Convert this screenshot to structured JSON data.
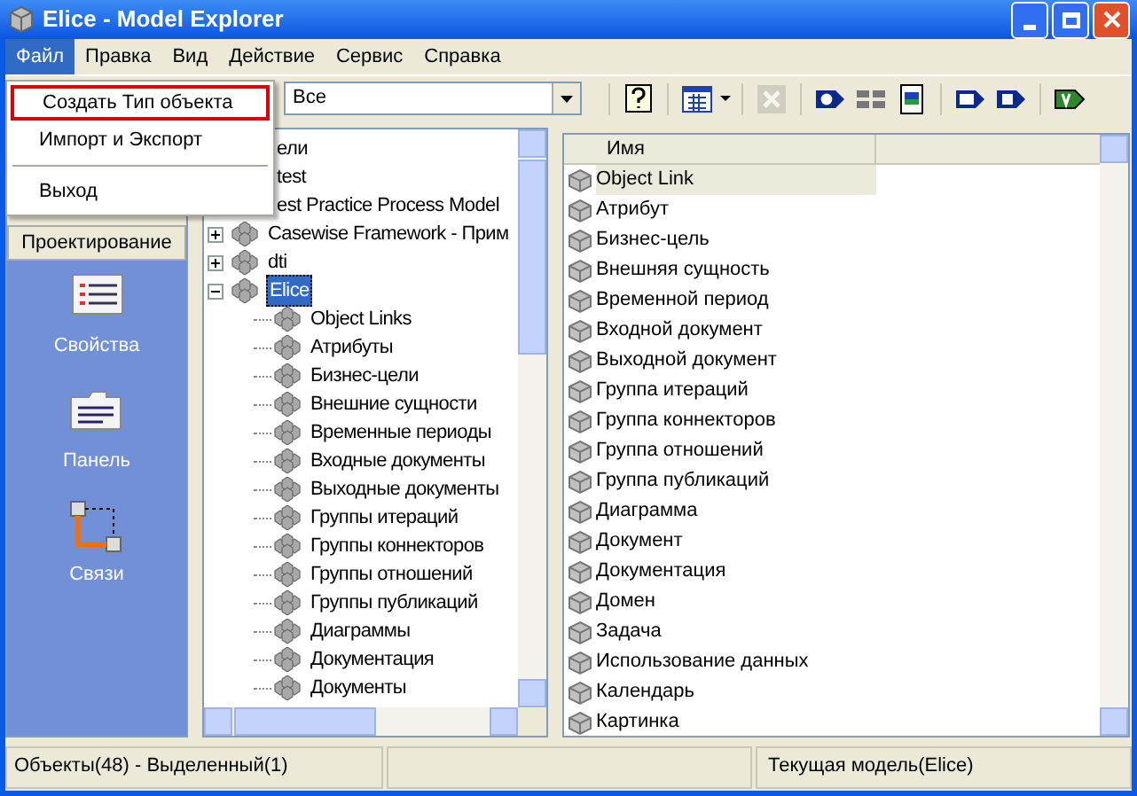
{
  "window": {
    "title": "Elice - Model Explorer"
  },
  "menu_bar": [
    {
      "label": "Файл",
      "selected": true
    },
    {
      "label": "Правка",
      "selected": false
    },
    {
      "label": "Вид",
      "selected": false
    },
    {
      "label": "Действие",
      "selected": false
    },
    {
      "label": "Сервис",
      "selected": false
    },
    {
      "label": "Справка",
      "selected": false
    }
  ],
  "file_menu": [
    {
      "kind": "item",
      "label": "Создать Тип объекта",
      "highlighted": true
    },
    {
      "kind": "item",
      "label": "Импорт и Экспорт",
      "highlighted": false
    },
    {
      "kind": "separator"
    },
    {
      "kind": "item",
      "label": "Выход",
      "highlighted": false
    }
  ],
  "toolbar": {
    "filter": {
      "value": "Все"
    },
    "tools": [
      {
        "kind": "help",
        "disabled": false
      },
      {
        "kind": "view",
        "disabled": false
      },
      {
        "kind": "delete",
        "disabled": true
      },
      {
        "kind": "number",
        "disabled": false
      },
      {
        "kind": "grid",
        "disabled": false
      },
      {
        "kind": "picture",
        "disabled": false
      },
      {
        "kind": "cp",
        "disabled": false
      },
      {
        "kind": "a",
        "disabled": false
      },
      {
        "kind": "v",
        "disabled": false
      }
    ]
  },
  "design_panel": {
    "title": "Проектирование",
    "items": [
      {
        "kind": "properties",
        "label": "Свойства"
      },
      {
        "kind": "panel",
        "label": "Панель"
      },
      {
        "kind": "links",
        "label": "Связи"
      }
    ]
  },
  "tree": [
    {
      "label": "ели",
      "selected": false
    },
    {
      "label": "test",
      "selected": false
    },
    {
      "label": "est Practice Process Model",
      "selected": false
    },
    {
      "label": "Casewise Framework - Прим",
      "expanded": false,
      "selected": false
    },
    {
      "label": "dti",
      "expanded": false,
      "selected": false
    },
    {
      "label": "Elice",
      "expanded": true,
      "selected": true,
      "children": [
        {
          "label": "Object Links",
          "selected": false
        },
        {
          "label": "Атрибуты",
          "selected": false
        },
        {
          "label": "Бизнес-цели",
          "selected": false
        },
        {
          "label": "Внешние сущности",
          "selected": false
        },
        {
          "label": "Временные периоды",
          "selected": false
        },
        {
          "label": "Входные документы",
          "selected": false
        },
        {
          "label": "Выходные документы",
          "selected": false
        },
        {
          "label": "Группы итераций",
          "selected": false
        },
        {
          "label": "Группы коннекторов",
          "selected": false
        },
        {
          "label": "Группы отношений",
          "selected": false
        },
        {
          "label": "Группы публикаций",
          "selected": false
        },
        {
          "label": "Диаграммы",
          "selected": false
        },
        {
          "label": "Документация",
          "selected": false
        },
        {
          "label": "Документы",
          "selected": false
        }
      ]
    }
  ],
  "list": {
    "column": "Имя",
    "rows": [
      {
        "label": "Object Link",
        "selected": true
      },
      {
        "label": "Атрибут",
        "selected": false
      },
      {
        "label": "Бизнес-цель",
        "selected": false
      },
      {
        "label": "Внешняя сущность",
        "selected": false
      },
      {
        "label": "Временной период",
        "selected": false
      },
      {
        "label": "Входной документ",
        "selected": false
      },
      {
        "label": "Выходной документ",
        "selected": false
      },
      {
        "label": "Группа итераций",
        "selected": false
      },
      {
        "label": "Группа коннекторов",
        "selected": false
      },
      {
        "label": "Группа отношений",
        "selected": false
      },
      {
        "label": "Группа публикаций",
        "selected": false
      },
      {
        "label": "Диаграмма",
        "selected": false
      },
      {
        "label": "Документ",
        "selected": false
      },
      {
        "label": "Документация",
        "selected": false
      },
      {
        "label": "Домен",
        "selected": false
      },
      {
        "label": "Задача",
        "selected": false
      },
      {
        "label": "Использование данных",
        "selected": false
      },
      {
        "label": "Календарь",
        "selected": false
      },
      {
        "label": "Картинка",
        "selected": false
      }
    ]
  },
  "status_bar": {
    "objects": "Объекты(48) - Выделенный(1)",
    "model": "Текущая модель(Elice)"
  }
}
